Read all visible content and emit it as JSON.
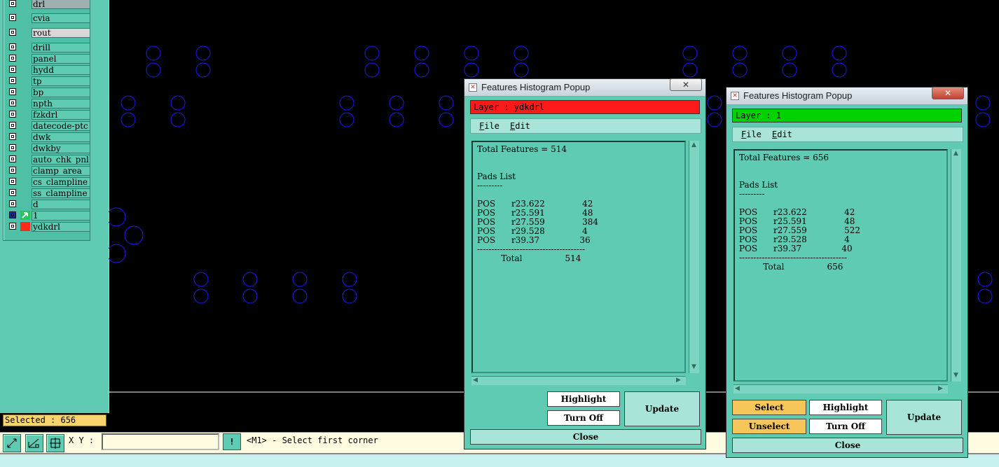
{
  "layers": [
    {
      "name": "drl",
      "style": "gray2"
    },
    {
      "name": "cvia"
    },
    {
      "name": "rout",
      "style": "gray"
    },
    {
      "name": "drill"
    },
    {
      "name": "panel"
    },
    {
      "name": "hydd"
    },
    {
      "name": "tp"
    },
    {
      "name": "bp"
    },
    {
      "name": "npth"
    },
    {
      "name": "fzkdrl"
    },
    {
      "name": "datecode-ptc"
    },
    {
      "name": "dwk"
    },
    {
      "name": "dwkby"
    },
    {
      "name": "auto_chk_pnl"
    },
    {
      "name": "clamp_area"
    },
    {
      "name": "cs_clampline"
    },
    {
      "name": "ss_clampline"
    },
    {
      "name": "d"
    },
    {
      "name": "1",
      "color": "#22c95a",
      "active": true
    },
    {
      "name": "ydkdrl",
      "color": "#ff2a1a"
    }
  ],
  "selected_text": "Selected : 656",
  "toolbar": {
    "xy_label": "X Y :",
    "xy_value": "",
    "excl_label": "!",
    "status_message": "<M1> - Select first corner"
  },
  "colors": {
    "accent": "#5fcbb3",
    "layer_ydkdrl": "#ff1a1a",
    "layer_1": "#00d200",
    "pad_outline": "#1a1aff"
  },
  "popup1": {
    "title": "Features Histogram Popup",
    "layer_label": "Layer :  ydkdrl",
    "layer_color": "#ff1a1a",
    "menu": [
      "File",
      "Edit"
    ],
    "histogram": "Total Features = 514\n\n\nPads List\n---------\n\nPOS      r23.622              42\nPOS      r25.591              48\nPOS      r27.559              384\nPOS      r29.528              4\nPOS      r39.37               36\n--------------------------------------\n         Total                514",
    "buttons": {
      "highlight": "Highlight",
      "turn_off": "Turn Off",
      "update": "Update",
      "close": "Close"
    }
  },
  "popup2": {
    "title": "Features Histogram Popup",
    "layer_label": "Layer :  1",
    "layer_color": "#00d200",
    "menu": [
      "File",
      "Edit"
    ],
    "histogram": "Total Features = 656\n\n\nPads List\n---------\n\nPOS      r23.622              42\nPOS      r25.591              48\nPOS      r27.559              522\nPOS      r29.528              4\nPOS      r39.37               40\n--------------------------------------\n         Total                656",
    "buttons": {
      "select": "Select",
      "unselect": "Unselect",
      "highlight": "Highlight",
      "turn_off": "Turn Off",
      "update": "Update",
      "close": "Close"
    }
  },
  "canvas": {
    "pad_rows": [
      {
        "xs": [
          219,
          290,
          531,
          602,
          673,
          744,
          985,
          1056,
          1127,
          1198
        ]
      },
      {
        "xs": [
          183,
          254,
          495,
          566,
          637,
          1020,
          1403
        ]
      },
      {
        "xs": [
          287,
          357,
          428,
          499,
          1406
        ]
      }
    ]
  }
}
